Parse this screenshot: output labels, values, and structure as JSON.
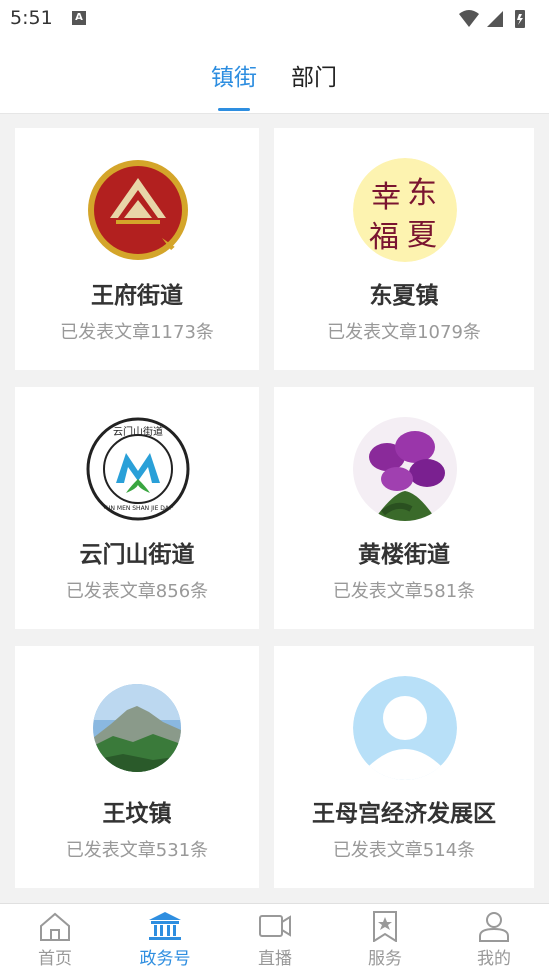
{
  "status": {
    "time": "5:51",
    "notif_letter": "A"
  },
  "tabs": [
    {
      "label": "镇街",
      "active": true
    },
    {
      "label": "部门",
      "active": false
    }
  ],
  "cards": [
    {
      "name": "王府街道",
      "count": "已发表文章1173条",
      "logo": "wangfu-logo"
    },
    {
      "name": "东夏镇",
      "count": "已发表文章1079条",
      "logo": "dongxia-logo"
    },
    {
      "name": "云门山街道",
      "count": "已发表文章856条",
      "logo": "yunmenshan-logo"
    },
    {
      "name": "黄楼街道",
      "count": "已发表文章581条",
      "logo": "huanglou-logo"
    },
    {
      "name": "王坟镇",
      "count": "已发表文章531条",
      "logo": "wangfen-logo"
    },
    {
      "name": "王母宫经济发展区",
      "count": "已发表文章514条",
      "logo": "default-avatar"
    }
  ],
  "logo_text": {
    "dongxia": [
      "幸",
      "东",
      "福",
      "夏"
    ],
    "yunmen_top": "云门山街道",
    "yunmen_bottom": "YUN MEN SHAN JIE DAO"
  },
  "nav": [
    {
      "label": "首页",
      "icon": "home-icon",
      "active": false
    },
    {
      "label": "政务号",
      "icon": "government-icon",
      "active": true
    },
    {
      "label": "直播",
      "icon": "video-icon",
      "active": false
    },
    {
      "label": "服务",
      "icon": "service-star-icon",
      "active": false
    },
    {
      "label": "我的",
      "icon": "user-icon",
      "active": false
    }
  ],
  "colors": {
    "accent": "#2e8ee0",
    "inactive": "#999999"
  }
}
